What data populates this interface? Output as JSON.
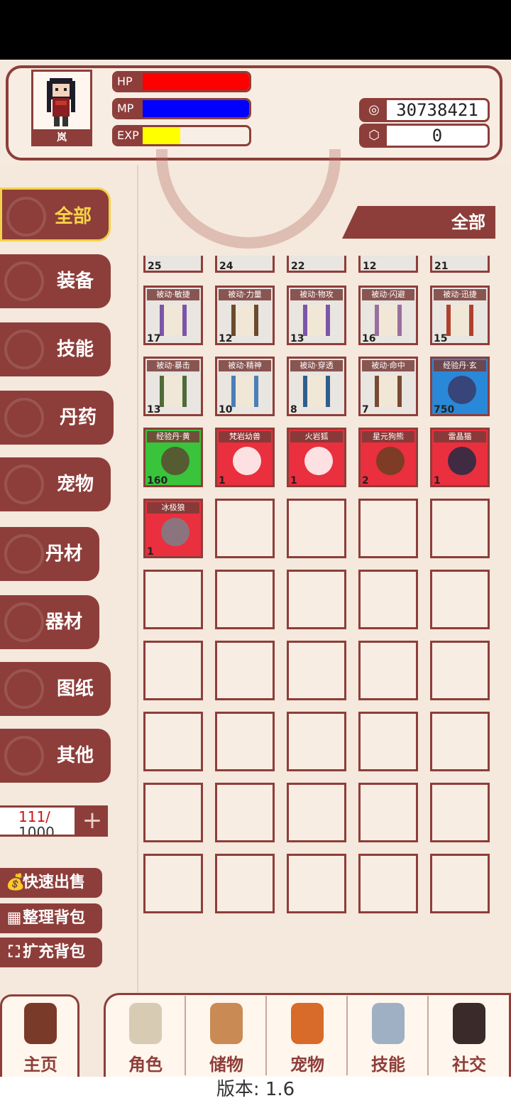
{
  "player": {
    "name": "岚",
    "hp_label": "HP",
    "mp_label": "MP",
    "exp_label": "EXP",
    "hp_fraction": 1.0,
    "mp_fraction": 1.0,
    "exp_fraction": 0.35,
    "colors": {
      "hp": "#ff0000",
      "mp": "#0000ff",
      "exp": "#ffff00"
    }
  },
  "currencies": [
    {
      "icon": "coin-icon",
      "value": "30738421"
    },
    {
      "icon": "crystal-icon",
      "value": "0"
    }
  ],
  "categories": [
    {
      "label": "全部",
      "active": true
    },
    {
      "label": "装备"
    },
    {
      "label": "技能"
    },
    {
      "label": "丹药"
    },
    {
      "label": "宠物"
    },
    {
      "label": "丹材"
    },
    {
      "label": "器材"
    },
    {
      "label": "图纸"
    },
    {
      "label": "其他"
    }
  ],
  "filter_label": "全部",
  "partial_row_counts": [
    "25",
    "24",
    "22",
    "12",
    "21"
  ],
  "items": [
    {
      "name": "被动·敏捷",
      "count": "17",
      "type": "scroll",
      "accent": "#7c55a8"
    },
    {
      "name": "被动·力量",
      "count": "12",
      "type": "scroll",
      "accent": "#6b4a2e"
    },
    {
      "name": "被动·物攻",
      "count": "13",
      "type": "scroll",
      "accent": "#7c55a8"
    },
    {
      "name": "被动·闪避",
      "count": "16",
      "type": "scroll",
      "accent": "#9a6f9e"
    },
    {
      "name": "被动·迅捷",
      "count": "15",
      "type": "scroll",
      "accent": "#b0402d"
    },
    {
      "name": "被动·暴击",
      "count": "13",
      "type": "scroll",
      "accent": "#4f6b3a"
    },
    {
      "name": "被动·精神",
      "count": "10",
      "type": "scroll",
      "accent": "#4a7fb8"
    },
    {
      "name": "被动·穿透",
      "count": "8",
      "type": "scroll",
      "accent": "#2e5e8c"
    },
    {
      "name": "被动·命中",
      "count": "7",
      "type": "scroll",
      "accent": "#7a4a30"
    },
    {
      "name": "经验丹·玄",
      "count": "750",
      "type": "blue",
      "accent": "#3a3a6a"
    },
    {
      "name": "经验丹·黄",
      "count": "160",
      "type": "green",
      "accent": "#5a4a30"
    },
    {
      "name": "梵岩幼兽",
      "count": "1",
      "type": "red",
      "accent": "#ffffff"
    },
    {
      "name": "火岩狐",
      "count": "1",
      "type": "red",
      "accent": "#ffffff"
    },
    {
      "name": "星元狗熊",
      "count": "2",
      "type": "red",
      "accent": "#6b3e22"
    },
    {
      "name": "雷晶猫",
      "count": "1",
      "type": "red",
      "accent": "#222a44"
    },
    {
      "name": "冰极狼",
      "count": "1",
      "type": "red",
      "accent": "#7a8088"
    }
  ],
  "capacity": {
    "used": "111/",
    "max": "1000"
  },
  "actions": [
    {
      "icon": "money-bag-icon",
      "glyph": "💰",
      "label": "快速出售"
    },
    {
      "icon": "grid-icon",
      "glyph": "▦",
      "label": "整理背包"
    },
    {
      "icon": "expand-icon",
      "glyph": "⛶",
      "label": "扩充背包"
    }
  ],
  "nav": [
    {
      "label": "主页",
      "icon": "home-gate-icon"
    },
    {
      "label": "角色",
      "icon": "character-icon"
    },
    {
      "label": "储物",
      "icon": "storage-bag-icon"
    },
    {
      "label": "宠物",
      "icon": "fox-pet-icon"
    },
    {
      "label": "技能",
      "icon": "sword-icon"
    },
    {
      "label": "社交",
      "icon": "handshake-icon"
    }
  ],
  "version_text": "版本: 1.6"
}
